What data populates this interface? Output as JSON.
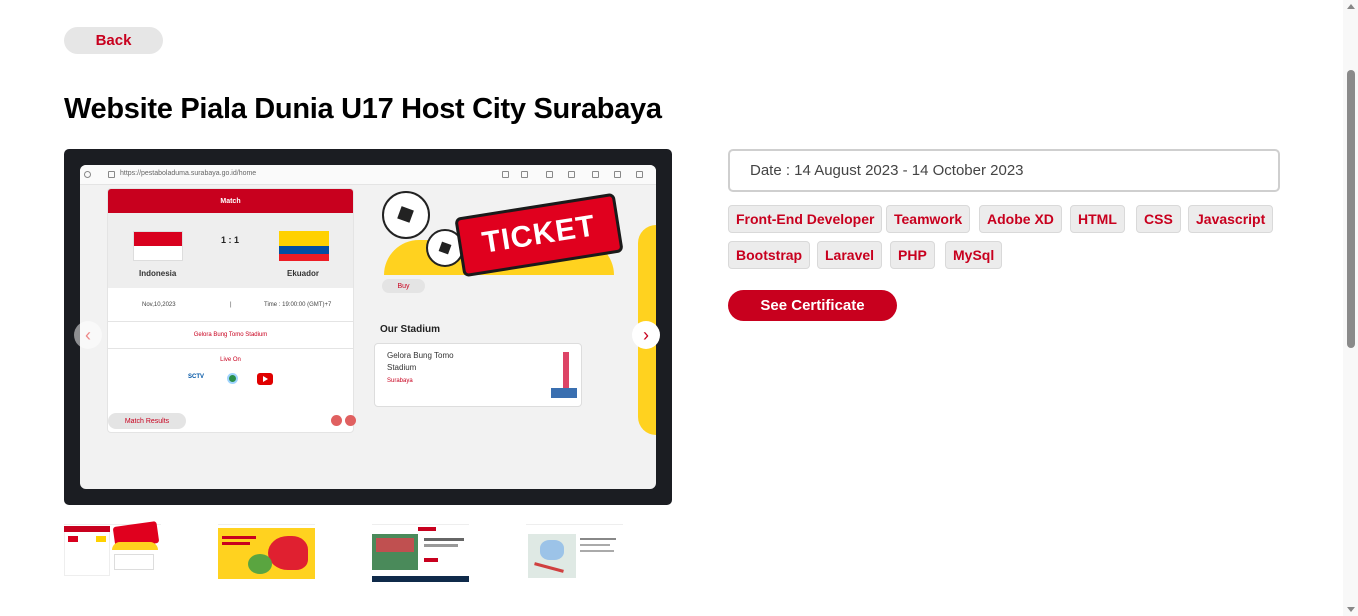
{
  "nav": {
    "back_label": "Back"
  },
  "project": {
    "title": "Website Piala Dunia U17 Host City Surabaya",
    "date_text": "Date : 14 August 2023 - 14 October 2023",
    "tags": [
      "Front-End Developer",
      "Teamwork",
      "Adobe XD",
      "HTML",
      "CSS",
      "Javascript",
      "Bootstrap",
      "Laravel",
      "PHP",
      "MySql"
    ],
    "certificate_label": "See Certificate"
  },
  "preview": {
    "url": "https://pestaboladuma.surabaya.go.id/home",
    "match_header": "Match",
    "score": "1 : 1",
    "team_home": "Indonesia",
    "team_away": "Ekuador",
    "match_date": "Nov,10,2023",
    "separator": "|",
    "match_time": "Time : 19:00:00 (GMT)+7",
    "stadium_line": "Gelora Bung Tomo Stadium",
    "live_label": "Live On",
    "channel_sctv": "SCTV",
    "match_results_label": "Match Results",
    "ticket_text": "TICKET",
    "buy_label": "Buy",
    "our_stadium_title": "Our Stadium",
    "stadium_name": "Gelora Bung Tomo Stadium",
    "stadium_city": "Surabaya"
  },
  "carousel": {
    "prev_icon": "chevron-left-icon",
    "next_icon": "chevron-right-icon",
    "prev_glyph": "‹",
    "next_glyph": "›"
  },
  "colors": {
    "accent": "#c8001e",
    "frame": "#1b1d22",
    "yellow": "#ffd21f"
  }
}
